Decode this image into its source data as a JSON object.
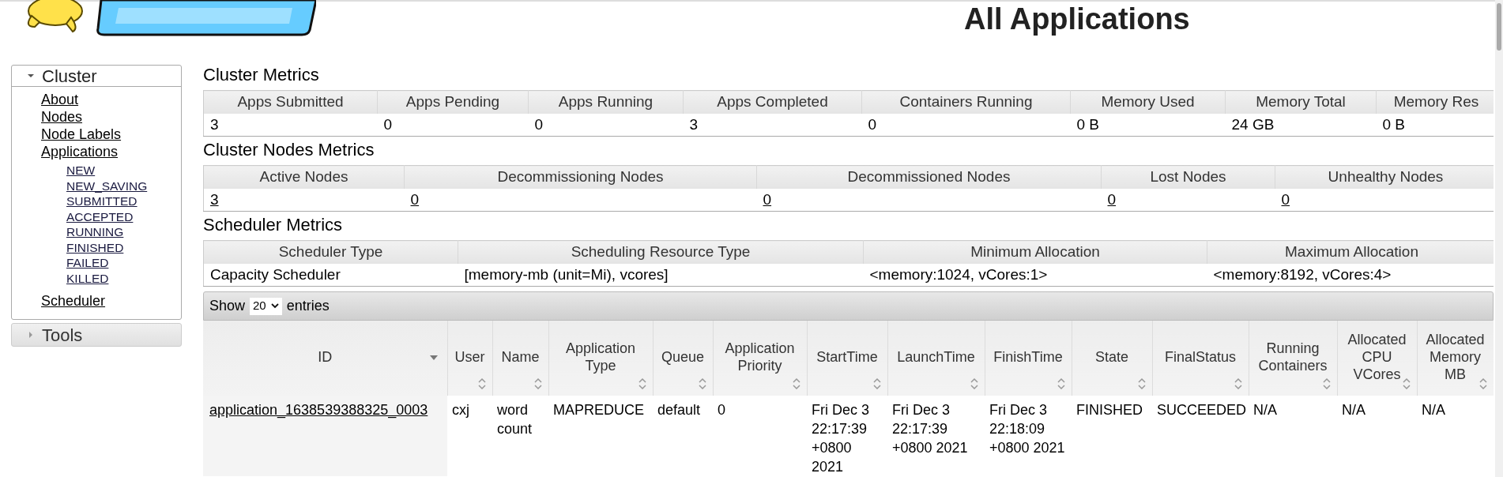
{
  "page_title": "All Applications",
  "sidebar": {
    "sections": [
      {
        "label": "Cluster",
        "expanded": true,
        "items": [
          {
            "label": "About"
          },
          {
            "label": "Nodes"
          },
          {
            "label": "Node Labels"
          },
          {
            "label": "Applications",
            "children": [
              {
                "label": "NEW"
              },
              {
                "label": "NEW_SAVING"
              },
              {
                "label": "SUBMITTED"
              },
              {
                "label": "ACCEPTED"
              },
              {
                "label": "RUNNING"
              },
              {
                "label": "FINISHED"
              },
              {
                "label": "FAILED"
              },
              {
                "label": "KILLED"
              }
            ]
          },
          {
            "label": "Scheduler"
          }
        ]
      },
      {
        "label": "Tools",
        "expanded": false
      }
    ]
  },
  "cluster_metrics": {
    "title": "Cluster Metrics",
    "columns": [
      "Apps Submitted",
      "Apps Pending",
      "Apps Running",
      "Apps Completed",
      "Containers Running",
      "Memory Used",
      "Memory Total",
      "Memory Res"
    ],
    "values": [
      "3",
      "0",
      "0",
      "3",
      "0",
      "0 B",
      "24 GB",
      "0 B"
    ]
  },
  "cluster_nodes_metrics": {
    "title": "Cluster Nodes Metrics",
    "columns": [
      "Active Nodes",
      "Decommissioning Nodes",
      "Decommissioned Nodes",
      "Lost Nodes",
      "Unhealthy Nodes"
    ],
    "values": [
      "3",
      "0",
      "0",
      "0",
      "0"
    ]
  },
  "scheduler_metrics": {
    "title": "Scheduler Metrics",
    "columns": [
      "Scheduler Type",
      "Scheduling Resource Type",
      "Minimum Allocation",
      "Maximum Allocation"
    ],
    "values": [
      "Capacity Scheduler",
      "[memory-mb (unit=Mi), vcores]",
      "<memory:1024, vCores:1>",
      "<memory:8192, vCores:4>"
    ]
  },
  "applications": {
    "show_label": "Show",
    "page_size": "20",
    "entries_label": "entries",
    "columns": [
      {
        "label": "ID",
        "sorted": true
      },
      {
        "label": "User",
        "sorted": false
      },
      {
        "label": "Name",
        "sorted": false
      },
      {
        "label": "Application Type",
        "sorted": false
      },
      {
        "label": "Queue",
        "sorted": false
      },
      {
        "label": "Application Priority",
        "sorted": false
      },
      {
        "label": "StartTime",
        "sorted": false
      },
      {
        "label": "LaunchTime",
        "sorted": false
      },
      {
        "label": "FinishTime",
        "sorted": false
      },
      {
        "label": "State",
        "sorted": false
      },
      {
        "label": "FinalStatus",
        "sorted": false
      },
      {
        "label": "Running Containers",
        "sorted": false
      },
      {
        "label": "Allocated CPU VCores",
        "sorted": false
      },
      {
        "label": "Allocated Memory MB",
        "sorted": false
      }
    ],
    "rows": [
      [
        "application_1638539388325_0003",
        "cxj",
        "word count",
        "MAPREDUCE",
        "default",
        "0",
        "Fri Dec 3 22:17:39 +0800 2021",
        "Fri Dec 3 22:17:39 +0800 2021",
        "Fri Dec 3 22:18:09 +0800 2021",
        "FINISHED",
        "SUCCEEDED",
        "N/A",
        "N/A",
        "N/A"
      ]
    ]
  }
}
